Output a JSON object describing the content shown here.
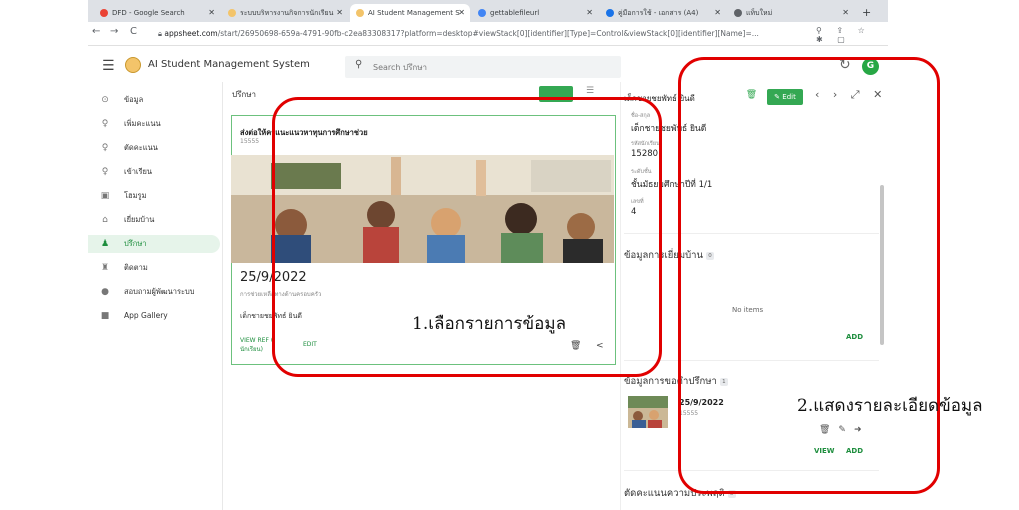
{
  "browser": {
    "tabs": [
      {
        "title": "DFD - Google Search",
        "active": false
      },
      {
        "title": "ระบบบริหารงานกิจการนักเรียน",
        "active": false
      },
      {
        "title": "AI Student Management S",
        "active": true
      },
      {
        "title": "gettablefileurl",
        "active": false
      },
      {
        "title": "คู่มือการใช้ - เอกสาร (A4)",
        "active": false
      },
      {
        "title": "แท็บใหม่",
        "active": false
      }
    ],
    "url_host": "appsheet.com",
    "url_path": "/start/26950698-659a-4791-90fb-c2ea83308317?platform=desktop#viewStack[0][identifier][Type]=Control&viewStack[0][identifier][Name]=..."
  },
  "app": {
    "title": "AI Student Management System",
    "search_placeholder": "Search ปรึกษา",
    "avatar_letter": "G"
  },
  "sidebar": {
    "items": [
      {
        "label": "ข้อมูล",
        "icon": "person-circle-icon",
        "glyph": "⊙",
        "active": false
      },
      {
        "label": "เพิ่มคะแนน",
        "icon": "person-add-icon",
        "glyph": "♀",
        "active": false
      },
      {
        "label": "ตัดคะแนน",
        "icon": "person-remove-icon",
        "glyph": "♀",
        "active": false
      },
      {
        "label": "เข้าเรียน",
        "icon": "person-check-icon",
        "glyph": "♀",
        "active": false
      },
      {
        "label": "โฮมรูม",
        "icon": "classroom-icon",
        "glyph": "▣",
        "active": false
      },
      {
        "label": "เยี่ยมบ้าน",
        "icon": "home-visit-icon",
        "glyph": "⌂",
        "active": false
      },
      {
        "label": "ปรึกษา",
        "icon": "counsel-icon",
        "glyph": "♟",
        "active": true
      },
      {
        "label": "ติดตาม",
        "icon": "follow-icon",
        "glyph": "♜",
        "active": false
      },
      {
        "label": "สอบถามผู้พัฒนาระบบ",
        "icon": "info-icon",
        "glyph": "●",
        "active": false
      },
      {
        "label": "App Gallery",
        "icon": "grid-icon",
        "glyph": "■",
        "active": false
      }
    ]
  },
  "list": {
    "header": "ปรึกษา",
    "card": {
      "title": "ส่งต่อให้ครูแนะแนวหาทุนการศึกษาช่วย",
      "subtitle": "15555",
      "date": "25/9/2022",
      "relation": "การช่วยเหลือทางด้านครอบครัว",
      "student": "เด็กชายชยพัทธ์ ยินดี",
      "view_ref": "VIEW REF (\nนักเรียน)",
      "edit": "EDIT"
    }
  },
  "detail": {
    "title": "เด็กชายชยพัทธ์ ยินดี",
    "edit_label": "Edit",
    "fields": [
      {
        "label": "ชื่อ-สกุล",
        "value": "เด็กชายชยพัทธ์ ยินดี"
      },
      {
        "label": "รหัสนักเรียน",
        "value": "15280"
      },
      {
        "label": "ระดับชั้น",
        "value": "ชั้นมัธยมศึกษาปีที่ 1/1"
      },
      {
        "label": "เลขที่",
        "value": "4"
      }
    ],
    "section_visit": {
      "title": "ข้อมูลการเยี่ยมบ้าน",
      "count": "0",
      "empty": "No items",
      "add": "ADD"
    },
    "section_counsel": {
      "title": "ข้อมูลการขอคำปรึกษา",
      "count": "1",
      "row_date": "25/9/2022",
      "row_sub": "15555",
      "view": "VIEW",
      "add": "ADD"
    },
    "section_behavior": {
      "title": "ตัดคะแนนความประพฤติ",
      "count": "0"
    }
  },
  "annotations": {
    "step1": "1.เลือกรายการข้อมูล",
    "step2": "2.แสดงรายละเอียดข้อมูล",
    "color": "#e10000"
  }
}
